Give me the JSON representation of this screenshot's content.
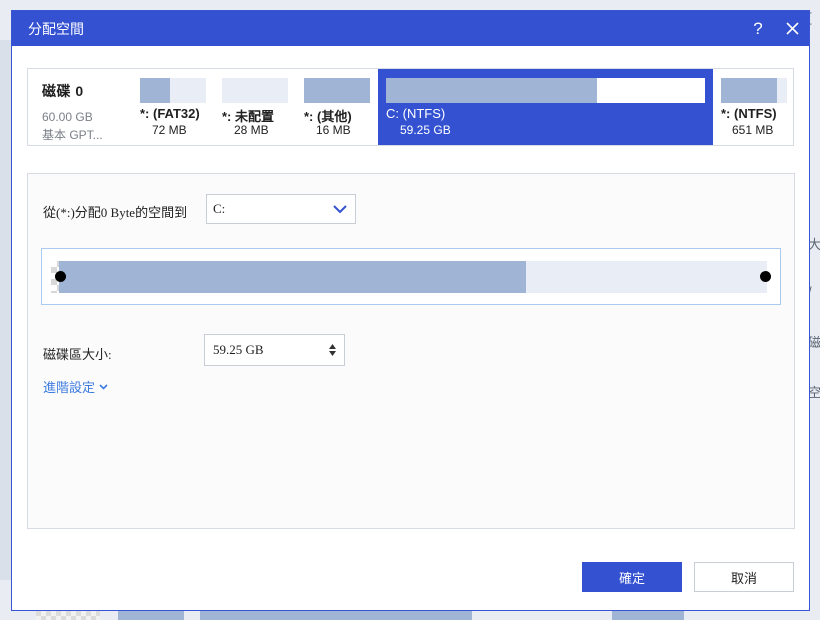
{
  "dialog": {
    "title": "分配空間",
    "help_label": "?",
    "ok_label": "確定",
    "cancel_label": "取消"
  },
  "disk": {
    "name": "磁碟 0",
    "size": "60.00 GB",
    "type": "基本 GPT..."
  },
  "partitions": [
    {
      "label": "*: (FAT32)",
      "size": "72 MB",
      "usage_fraction": 0.45
    },
    {
      "label": "*: 未配置",
      "size": "28 MB",
      "unallocated": true
    },
    {
      "label": "*: (其他)",
      "size": "16 MB",
      "usage_fraction": 1.0
    },
    {
      "label": "C: (NTFS)",
      "size": "59.25 GB",
      "usage_fraction": 0.66,
      "selected": true
    },
    {
      "label": "*: (NTFS)",
      "size": "651 MB",
      "usage_fraction": 0.85
    }
  ],
  "allocate": {
    "label": "從(*:)分配0 Byte的空間到",
    "target": "C:"
  },
  "resize": {
    "used_fraction": 0.66
  },
  "partition_size": {
    "label": "磁碟區大小:",
    "value": "59.25 GB"
  },
  "advanced_label": "進階設定",
  "background": {
    "right_texts": [
      "[",
      "大",
      "/",
      "磁",
      "空"
    ]
  },
  "colors": {
    "accent": "#3351d1",
    "bar_fill": "#a0b5d5",
    "link": "#3d7be0"
  }
}
